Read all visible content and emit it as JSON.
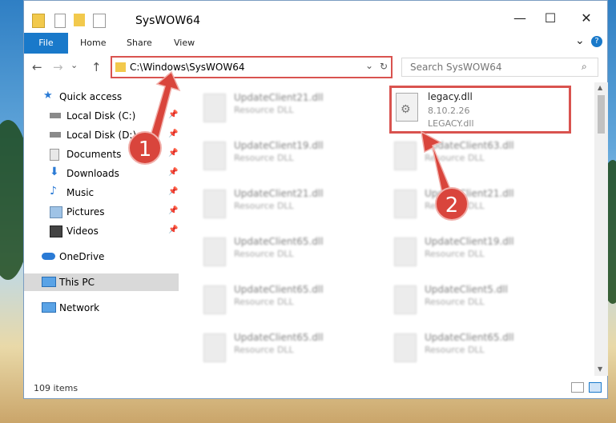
{
  "window": {
    "title": "SysWOW64",
    "controls": {
      "minimize": "—",
      "maximize": "☐",
      "close": "✕"
    }
  },
  "ribbon": {
    "file": "File",
    "tabs": [
      "Home",
      "Share",
      "View"
    ],
    "expand": "⌄",
    "help": "?"
  },
  "nav": {
    "back": "←",
    "forward": "→",
    "recent": "⌄",
    "up": "↑",
    "address": "C:\\Windows\\SysWOW64",
    "search_placeholder": "Search SysWOW64"
  },
  "sidebar": {
    "items": [
      {
        "label": "Quick access",
        "icon": "star-icon"
      },
      {
        "label": "Local Disk (C:)",
        "icon": "drive-icon",
        "pinned": true
      },
      {
        "label": "Local Disk (D:)",
        "icon": "drive-icon",
        "pinned": true
      },
      {
        "label": "Documents",
        "icon": "documents-icon",
        "pinned": true
      },
      {
        "label": "Downloads",
        "icon": "download-icon",
        "pinned": true
      },
      {
        "label": "Music",
        "icon": "music-icon",
        "pinned": true
      },
      {
        "label": "Pictures",
        "icon": "pictures-icon",
        "pinned": true
      },
      {
        "label": "Videos",
        "icon": "videos-icon",
        "pinned": true
      },
      {
        "label": "OneDrive",
        "icon": "cloud-icon"
      },
      {
        "label": "This PC",
        "icon": "pc-icon",
        "selected": true
      },
      {
        "label": "Network",
        "icon": "network-icon"
      }
    ]
  },
  "files": {
    "left": [
      {
        "name": "UpdateClient21.dll",
        "desc": "Resource DLL"
      },
      {
        "name": "UpdateClient19.dll",
        "desc": "Resource DLL"
      },
      {
        "name": "UpdateClient21.dll",
        "desc": "Resource DLL"
      },
      {
        "name": "UpdateClient65.dll",
        "desc": "Resource DLL"
      },
      {
        "name": "UpdateClient65.dll",
        "desc": "Resource DLL"
      },
      {
        "name": "UpdateClient65.dll",
        "desc": "Resource DLL"
      }
    ],
    "right": [
      {
        "name": "legacy.dll",
        "version": "8.10.2.26",
        "desc": "LEGACY.dll",
        "selected": true
      },
      {
        "name": "UpdateClient63.dll",
        "desc": "Resource DLL"
      },
      {
        "name": "UpdateClient21.dll",
        "desc": "Resource DLL"
      },
      {
        "name": "UpdateClient19.dll",
        "desc": "Resource DLL"
      },
      {
        "name": "UpdateClient5.dll",
        "desc": "Resource DLL"
      },
      {
        "name": "UpdateClient65.dll",
        "desc": "Resource DLL"
      }
    ]
  },
  "status": {
    "count": "109 items"
  },
  "annotations": {
    "step1": "1",
    "step2": "2"
  },
  "colors": {
    "accent": "#1979ca",
    "highlight": "#d9534f"
  }
}
